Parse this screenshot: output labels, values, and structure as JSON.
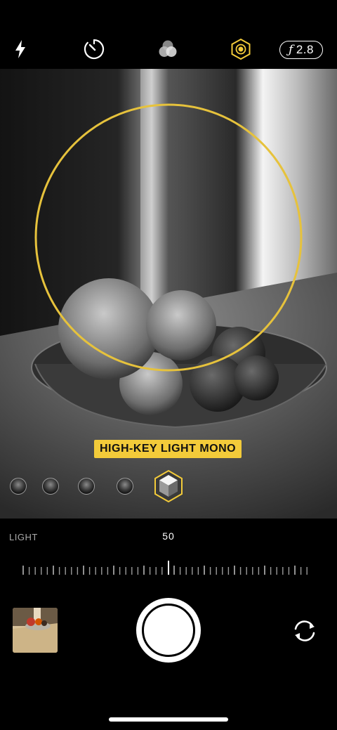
{
  "toolbar": {
    "icons": [
      "flash-icon",
      "timer-icon",
      "filters-icon",
      "portrait-lighting-icon"
    ],
    "aperture_symbol": "ƒ",
    "aperture_value": "2.8",
    "accent": "#f3cb3a"
  },
  "viewfinder": {
    "effect_label": "HIGH-KEY LIGHT MONO",
    "lighting_options": 5,
    "selected_lighting": 4
  },
  "slider": {
    "title": "LIGHT",
    "value": "50"
  },
  "controls": {
    "thumbnail": "last-photo-thumbnail",
    "shutter": "shutter-button",
    "flip": "camera-flip-icon"
  }
}
